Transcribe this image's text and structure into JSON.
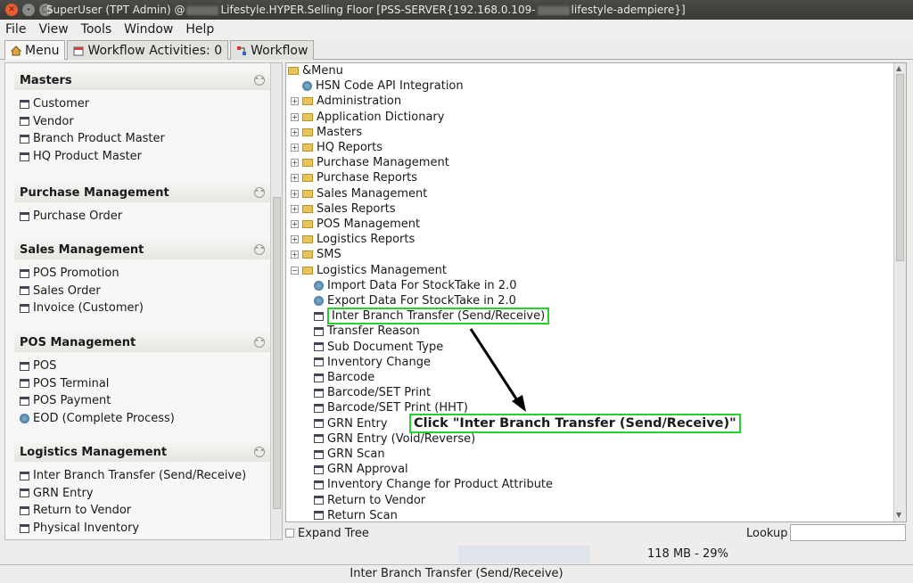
{
  "titlebar": {
    "text_a": "SuperUser (TPT Admin) @",
    "text_b": "Lifestyle.HYPER.Selling Floor [PSS-SERVER{192.168.0.109-",
    "text_c": "lifestyle-adempiere}]",
    "close_label": "✕",
    "min_label": "–",
    "max_label": "▢"
  },
  "menubar": {
    "items": [
      "File",
      "View",
      "Tools",
      "Window",
      "Help"
    ]
  },
  "tabs": [
    {
      "label": "Menu"
    },
    {
      "label": "Workflow Activities: 0"
    },
    {
      "label": "Workflow"
    }
  ],
  "sections": [
    {
      "title": "Masters",
      "items": [
        {
          "label": "Customer",
          "icon": "window-icon"
        },
        {
          "label": "Vendor",
          "icon": "window-icon"
        },
        {
          "label": "Branch Product Master",
          "icon": "window-icon"
        },
        {
          "label": "HQ Product Master",
          "icon": "window-icon"
        }
      ]
    },
    {
      "title": "Purchase Management",
      "items": [
        {
          "label": "Purchase Order",
          "icon": "window-icon"
        }
      ]
    },
    {
      "title": "Sales Management",
      "items": [
        {
          "label": "POS Promotion",
          "icon": "window-icon"
        },
        {
          "label": "Sales Order",
          "icon": "window-icon"
        },
        {
          "label": "Invoice (Customer)",
          "icon": "window-icon"
        }
      ]
    },
    {
      "title": "POS Management",
      "items": [
        {
          "label": "POS",
          "icon": "window-icon"
        },
        {
          "label": "POS Terminal",
          "icon": "window-icon"
        },
        {
          "label": "POS Payment",
          "icon": "window-icon"
        },
        {
          "label": "EOD (Complete Process)",
          "icon": "process-icon"
        }
      ]
    },
    {
      "title": "Logistics Management",
      "items": [
        {
          "label": "Inter Branch Transfer (Send/Receive)",
          "icon": "window-icon"
        },
        {
          "label": "GRN Entry",
          "icon": "window-icon"
        },
        {
          "label": "Return to Vendor",
          "icon": "window-icon"
        },
        {
          "label": "Physical Inventory",
          "icon": "window-icon"
        }
      ]
    }
  ],
  "tree": {
    "root": "&Menu",
    "top_items": [
      {
        "label": "HSN Code API Integration",
        "type": "process"
      },
      {
        "label": "Administration",
        "type": "folder"
      },
      {
        "label": "Application Dictionary",
        "type": "folder"
      },
      {
        "label": "Masters",
        "type": "folder"
      },
      {
        "label": "HQ Reports",
        "type": "folder"
      },
      {
        "label": "Purchase Management",
        "type": "folder"
      },
      {
        "label": "Purchase Reports",
        "type": "folder"
      },
      {
        "label": "Sales Management",
        "type": "folder"
      },
      {
        "label": "Sales Reports",
        "type": "folder"
      },
      {
        "label": "POS Management",
        "type": "folder"
      },
      {
        "label": "Logistics Reports",
        "type": "folder"
      },
      {
        "label": "SMS",
        "type": "folder"
      },
      {
        "label": "Logistics Management",
        "type": "folder-open"
      }
    ],
    "logistics_children": [
      {
        "label": "Import Data For StockTake in 2.0",
        "type": "process"
      },
      {
        "label": "Export Data For StockTake in 2.0",
        "type": "process"
      },
      {
        "label": "Inter Branch Transfer (Send/Receive)",
        "type": "window",
        "highlight": true
      },
      {
        "label": "Transfer Reason",
        "type": "window"
      },
      {
        "label": "Sub Document Type",
        "type": "window"
      },
      {
        "label": "Inventory Change",
        "type": "window"
      },
      {
        "label": "Barcode",
        "type": "window"
      },
      {
        "label": "Barcode/SET Print",
        "type": "window"
      },
      {
        "label": "Barcode/SET Print (HHT)",
        "type": "window"
      },
      {
        "label": "GRN Entry",
        "type": "window"
      },
      {
        "label": "GRN Entry (Void/Reverse)",
        "type": "window"
      },
      {
        "label": "GRN Scan",
        "type": "window"
      },
      {
        "label": "GRN Approval",
        "type": "window"
      },
      {
        "label": "Inventory Change for Product Attribute",
        "type": "window"
      },
      {
        "label": "Return to Vendor",
        "type": "window"
      },
      {
        "label": "Return Scan",
        "type": "window"
      }
    ]
  },
  "annotation": {
    "text": "Click \"Inter Branch Transfer (Send/Receive)\""
  },
  "bottom": {
    "expand_tree": "Expand Tree",
    "lookup": "Lookup"
  },
  "status": {
    "memory": "118 MB - 29%",
    "footer": "Inter Branch Transfer (Send/Receive)"
  },
  "colors": {
    "highlight": "#22d42a",
    "titlebar": "#3c3c3a"
  }
}
